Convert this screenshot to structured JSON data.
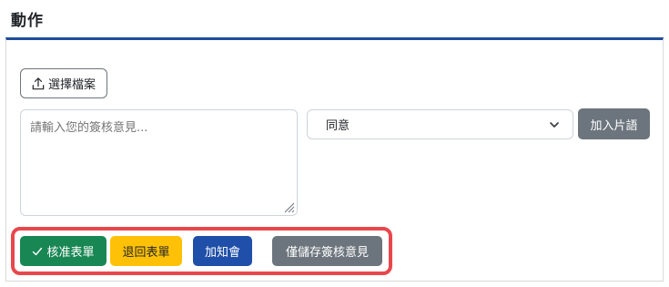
{
  "section": {
    "title": "動作"
  },
  "upload": {
    "label": "選擇檔案",
    "icon": "upload-icon"
  },
  "comment": {
    "placeholder": "請輸入您的簽核意見..."
  },
  "phrase": {
    "selected": "同意",
    "add_label": "加入片語"
  },
  "actions": {
    "approve_label": "核准表單",
    "return_label": "退回表單",
    "notify_label": "加知會",
    "save_label": "僅儲存簽核意見"
  },
  "colors": {
    "primary": "#1f4fa8",
    "success": "#198754",
    "warning": "#ffc107",
    "secondary": "#6c757d",
    "highlight": "#e8474c"
  }
}
